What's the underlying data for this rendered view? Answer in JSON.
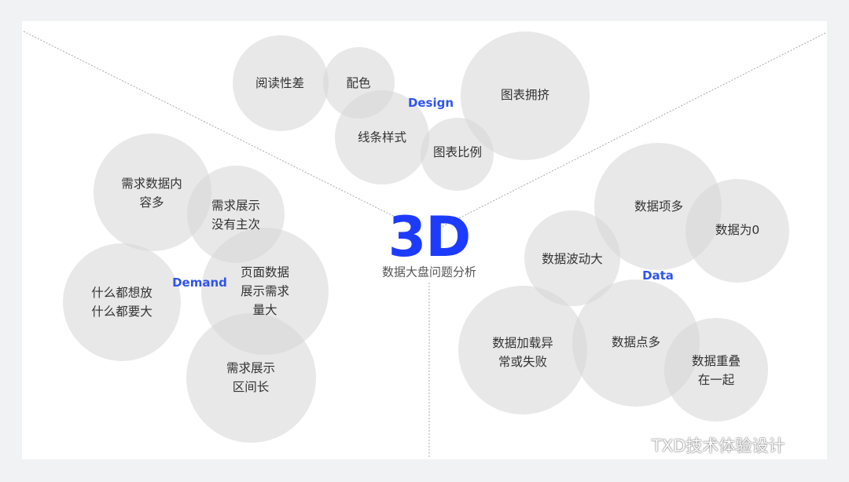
{
  "center": {
    "title": "3D",
    "subtitle": "数据大盘问题分析"
  },
  "groups": {
    "design": "Design",
    "demand": "Demand",
    "data": "Data"
  },
  "bubbles": {
    "design": {
      "yuedu": "阅读性差",
      "peise": "配色",
      "xiantiao": "线条样式",
      "yongji": "图表拥挤",
      "bili": "图表比例"
    },
    "demand": {
      "neirong": "需求数据内\n容多",
      "zhuci": "需求展示\n没有主次",
      "liangda": "页面数据\n展示需求\n量大",
      "shenme": "什么都想放\n什么都要大",
      "qujian": "需求展示\n区间长"
    },
    "data": {
      "xiangduo": "数据项多",
      "wei0": "数据为0",
      "bodong": "数据波动大",
      "yichang": "数据加载异\n常或失败",
      "dianduo": "数据点多",
      "chongdie": "数据重叠\n在一起"
    }
  },
  "watermark": {
    "text": "TXD技术体验设计",
    "icon": "wechat-icon"
  },
  "colors": {
    "accent": "#1d3bff",
    "group_label": "#2f54eb",
    "bubble": "#d6d6d6",
    "background": "#f1f2f4"
  }
}
